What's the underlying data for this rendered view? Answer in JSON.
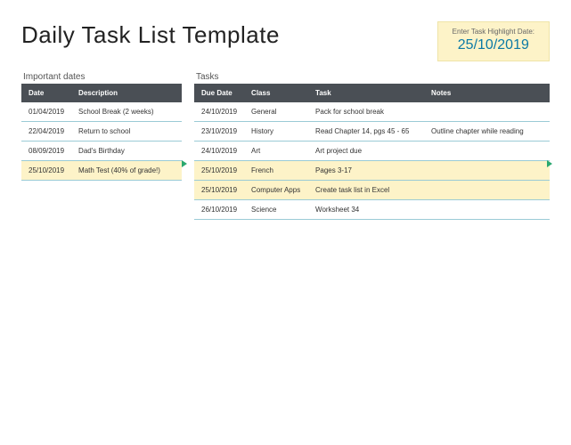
{
  "header": {
    "title": "Daily Task List Template",
    "highlight_label": "Enter Task Highlight Date:",
    "highlight_date": "25/10/2019"
  },
  "important_dates": {
    "title": "Important dates",
    "columns": {
      "date": "Date",
      "description": "Description"
    },
    "rows": [
      {
        "date": "01/04/2019",
        "description": "School Break (2 weeks)",
        "highlight": false
      },
      {
        "date": "22/04/2019",
        "description": "Return to school",
        "highlight": false
      },
      {
        "date": "08/09/2019",
        "description": "Dad's Birthday",
        "highlight": false
      },
      {
        "date": "25/10/2019",
        "description": "Math Test (40% of grade!)",
        "highlight": true
      }
    ]
  },
  "tasks": {
    "title": "Tasks",
    "columns": {
      "due_date": "Due Date",
      "class": "Class",
      "task": "Task",
      "notes": "Notes"
    },
    "rows": [
      {
        "due_date": "24/10/2019",
        "class": "General",
        "task": "Pack for school break",
        "notes": "",
        "highlight": false
      },
      {
        "due_date": "23/10/2019",
        "class": "History",
        "task": "Read Chapter 14, pgs 45 - 65",
        "notes": "Outline chapter while reading",
        "highlight": false
      },
      {
        "due_date": "24/10/2019",
        "class": "Art",
        "task": "Art project due",
        "notes": "",
        "highlight": false
      },
      {
        "due_date": "25/10/2019",
        "class": "French",
        "task": "Pages 3-17",
        "notes": "",
        "highlight": true
      },
      {
        "due_date": "25/10/2019",
        "class": "Computer Apps",
        "task": "Create task list in Excel",
        "notes": "",
        "highlight": true
      },
      {
        "due_date": "26/10/2019",
        "class": "Science",
        "task": "Worksheet 34",
        "notes": "",
        "highlight": false
      }
    ]
  }
}
